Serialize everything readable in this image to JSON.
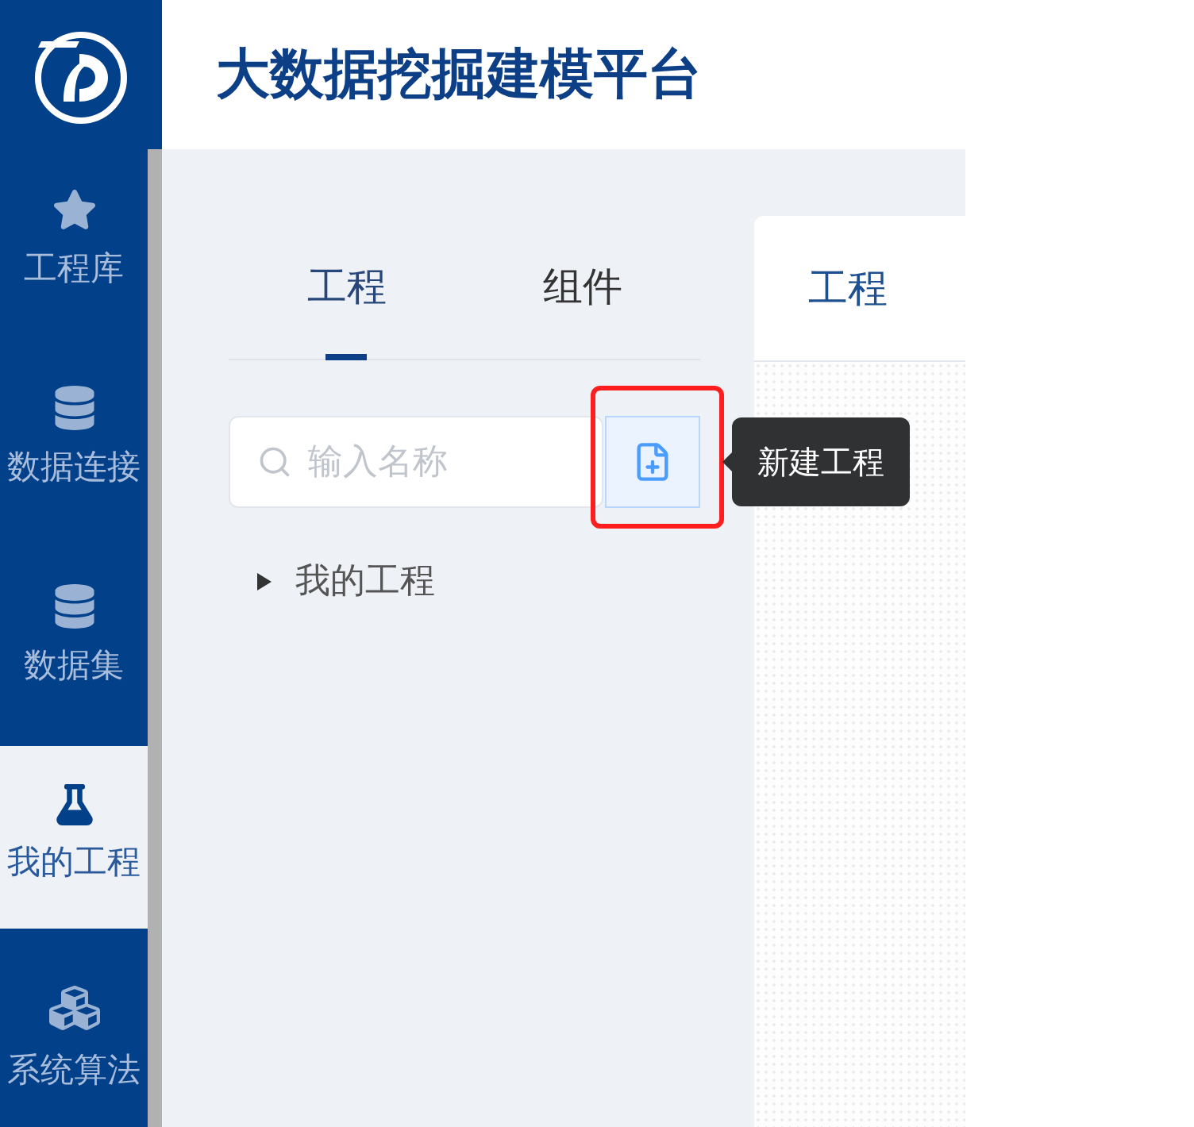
{
  "header": {
    "title": "大数据挖掘建模平台"
  },
  "sidebar": {
    "items": [
      {
        "label": "工程库",
        "selected": false
      },
      {
        "label": "数据连接",
        "selected": false
      },
      {
        "label": "数据集",
        "selected": false
      },
      {
        "label": "我的工程",
        "selected": true
      },
      {
        "label": "系统算法",
        "selected": false
      }
    ]
  },
  "left_panel": {
    "tabs": [
      {
        "label": "工程",
        "selected": true
      },
      {
        "label": "组件",
        "selected": false
      }
    ],
    "search": {
      "placeholder": "输入名称"
    },
    "new_button": {
      "highlighted": true,
      "tooltip": "新建工程"
    },
    "tree": [
      {
        "label": "我的工程",
        "expanded": false
      }
    ]
  },
  "canvas_panel": {
    "title": "工程"
  }
}
